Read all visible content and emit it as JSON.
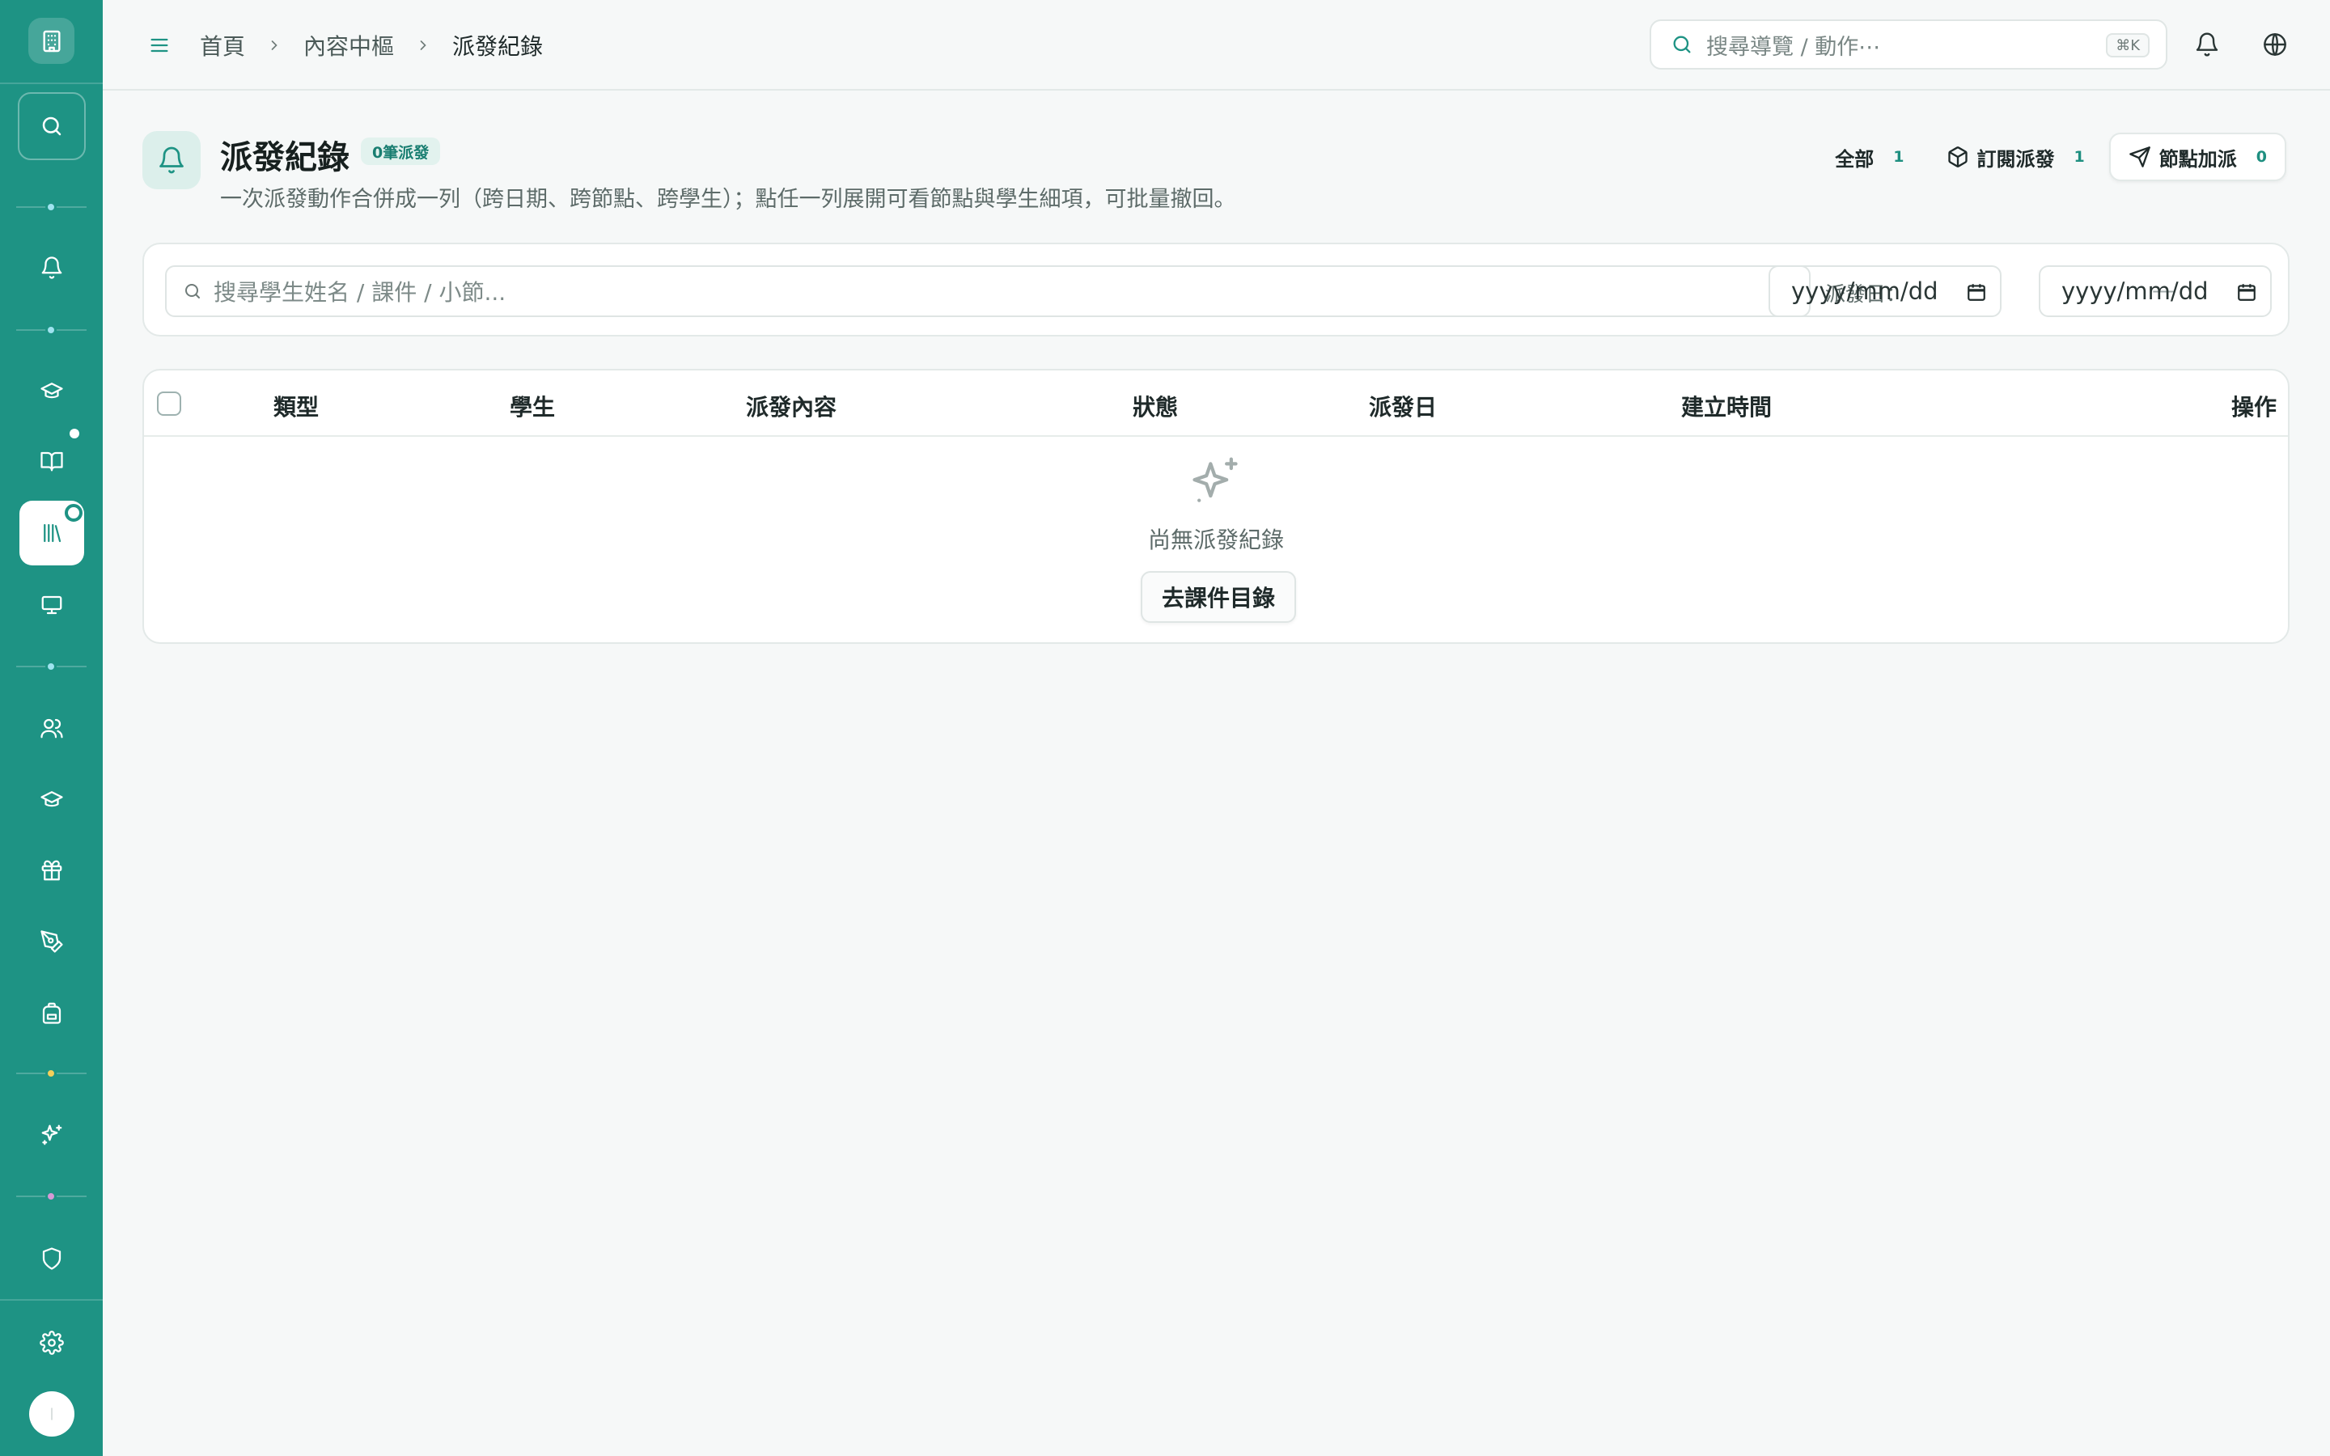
{
  "topbar": {
    "breadcrumbs": [
      "首頁",
      "內容中樞",
      "派發紀錄"
    ],
    "search_placeholder": "搜尋導覽 / 動作⋯",
    "search_shortcut": "⌘K"
  },
  "page": {
    "title": "派發紀錄",
    "badge": "0筆派發",
    "description": "一次派發動作合併成一列（跨日期、跨節點、跨學生）；點任一列展開可看節點與學生細項，可批量撤回。",
    "filters": [
      {
        "label": "全部",
        "count": "1"
      },
      {
        "label": "訂閱派發",
        "count": "1"
      },
      {
        "label": "節點加派",
        "count": "0"
      }
    ]
  },
  "search": {
    "placeholder": "搜尋學生姓名 / 課件 / 小節...",
    "date_label": "派發日：",
    "date_from_placeholder": "yyyy/mm/dd",
    "date_to_placeholder": "yyyy/mm/dd",
    "date_separator": "—"
  },
  "table": {
    "columns": [
      "類型",
      "學生",
      "派發內容",
      "狀態",
      "派發日",
      "建立時間",
      "操作"
    ],
    "empty_text": "尚無派發紀錄",
    "empty_action": "去課件目錄"
  },
  "colors": {
    "sidebar": "#1e9384",
    "accent": "#197e71",
    "separator_dots": [
      "#9fe3ef",
      "#9fe3ef",
      "#9fe3ef",
      "#f5cf5a",
      "#d59ad6"
    ]
  },
  "icons": {
    "sidebar": [
      "building-icon",
      "search-icon",
      "bell-icon",
      "graduation-cap-icon",
      "book-open-icon",
      "library-icon",
      "monitor-icon",
      "users-icon",
      "graduation-cap-icon",
      "gift-icon",
      "pen-tool-icon",
      "backpack-icon",
      "sparkles-icon",
      "shield-icon",
      "gear-icon"
    ]
  }
}
